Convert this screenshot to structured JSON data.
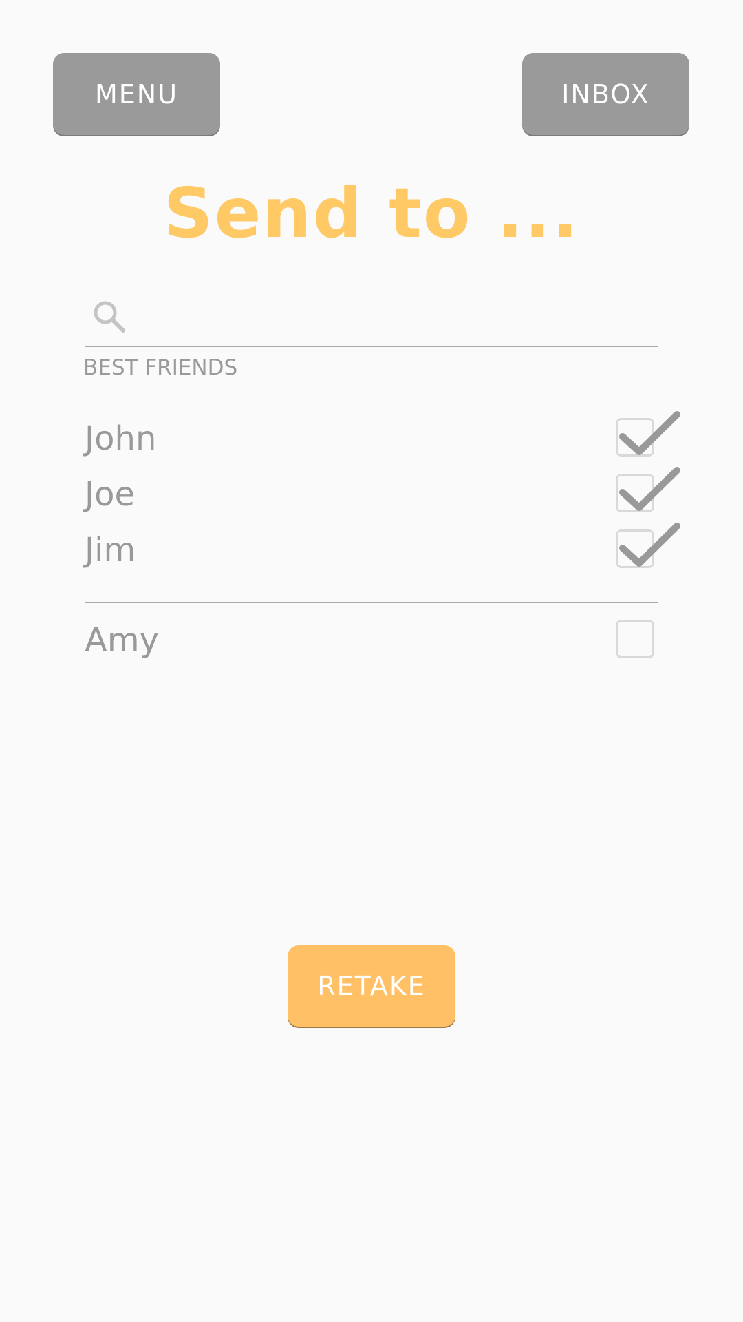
{
  "header": {
    "menu_label": "MENU",
    "inbox_label": "INBOX"
  },
  "title": "Send to ...",
  "search": {
    "placeholder": "",
    "value": ""
  },
  "sections": {
    "best_friends_label": "BEST FRIENDS"
  },
  "best_friends": [
    {
      "name": "John",
      "checked": true
    },
    {
      "name": "Joe",
      "checked": true
    },
    {
      "name": "Jim",
      "checked": true
    }
  ],
  "others": [
    {
      "name": "Amy",
      "checked": false
    }
  ],
  "footer": {
    "retake_label": "RETAKE"
  },
  "colors": {
    "accent": "#ffc966",
    "button_gray": "#9a9a9a",
    "retake_orange": "#ffc066",
    "text_gray": "#999999"
  }
}
